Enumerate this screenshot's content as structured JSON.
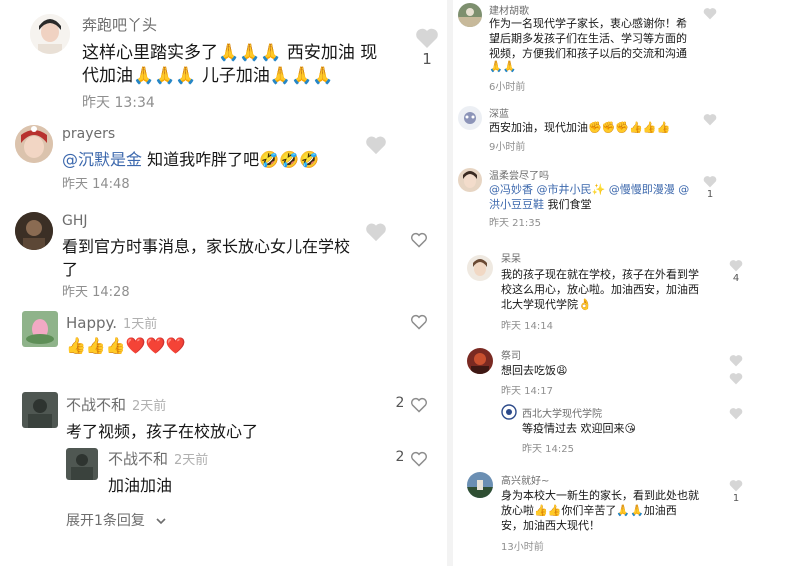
{
  "left": {
    "c1": {
      "name": "奔跑吧丫头",
      "line1": "这样心里踏实多了🙏🙏🙏 西安加油 现",
      "line2": "代加油🙏🙏🙏 儿子加油🙏🙏🙏",
      "time": "昨天 13:34",
      "likes": "1"
    },
    "c2": {
      "name": "prayers",
      "mention": "@沉默是金",
      "rest": " 知道我咋胖了吧🤣🤣🤣",
      "time": "昨天 14:48"
    },
    "c3": {
      "name": "GHJ",
      "line1": "看到官方时事消息，家长放心女儿在学校",
      "line2": "了",
      "time": "昨天 14:28"
    },
    "c4": {
      "name": "Happy.",
      "ago": "1天前",
      "text": "👍👍👍❤️❤️❤️"
    },
    "c5": {
      "name": "不战不和",
      "ago": "2天前",
      "text": "考了视频，孩子在校放心了",
      "likes": "2"
    },
    "c6": {
      "name": "不战不和",
      "ago": "2天前",
      "text": "加油加油",
      "likes": "2"
    },
    "more": "展开1条回复"
  },
  "right": {
    "r1": {
      "name": "建材胡歌",
      "l1": "作为一名现代学子家长，衷心感谢你！希",
      "l2": "望后期多发孩子们在生活、学习等方面的",
      "l3": "视频，方便我们和孩子以后的交流和沟通",
      "l4": "🙏🙏",
      "time": "6小时前"
    },
    "r2": {
      "name": "深蓝",
      "text": "西安加油，现代加油✊✊✊👍👍👍",
      "time": "9小时前"
    },
    "r3": {
      "name": "温柔尝尽了吗",
      "l1a": "@冯妙香",
      "l1b": "@市井小民✨",
      "l1c": "@慢慢即漫漫",
      "l1d": "@",
      "l2a": "洪小豆豆鞋",
      "l2b": " 我们食堂",
      "time": "昨天 21:35",
      "likes": "1"
    },
    "r4": {
      "name": "呆呆",
      "l1": "我的孩子现在就在学校，孩子在外看到学",
      "l2": "校这么用心，放心啦。加油西安，加油西",
      "l3": "北大学现代学院👌",
      "time": "昨天 14:14",
      "likes": "4"
    },
    "r5": {
      "name": "祭司",
      "text": "想回去吃饭😩",
      "time": "昨天 14:17"
    },
    "r6": {
      "name": "西北大学现代学院",
      "text": "等疫情过去 欢迎回来😘",
      "time": "昨天 14:25"
    },
    "r7": {
      "name": "高兴就好~",
      "l1": "身为本校大一新生的家长，看到此处也就",
      "l2": "放心啦👍👍你们辛苦了🙏🙏加油西",
      "l3": "安，加油西大现代！",
      "time": "13小时前",
      "likes": "1"
    }
  },
  "colors": {
    "heart_outline": "#c8c8c8",
    "mention": "#3c68ad",
    "time": "#8f8f8f"
  }
}
